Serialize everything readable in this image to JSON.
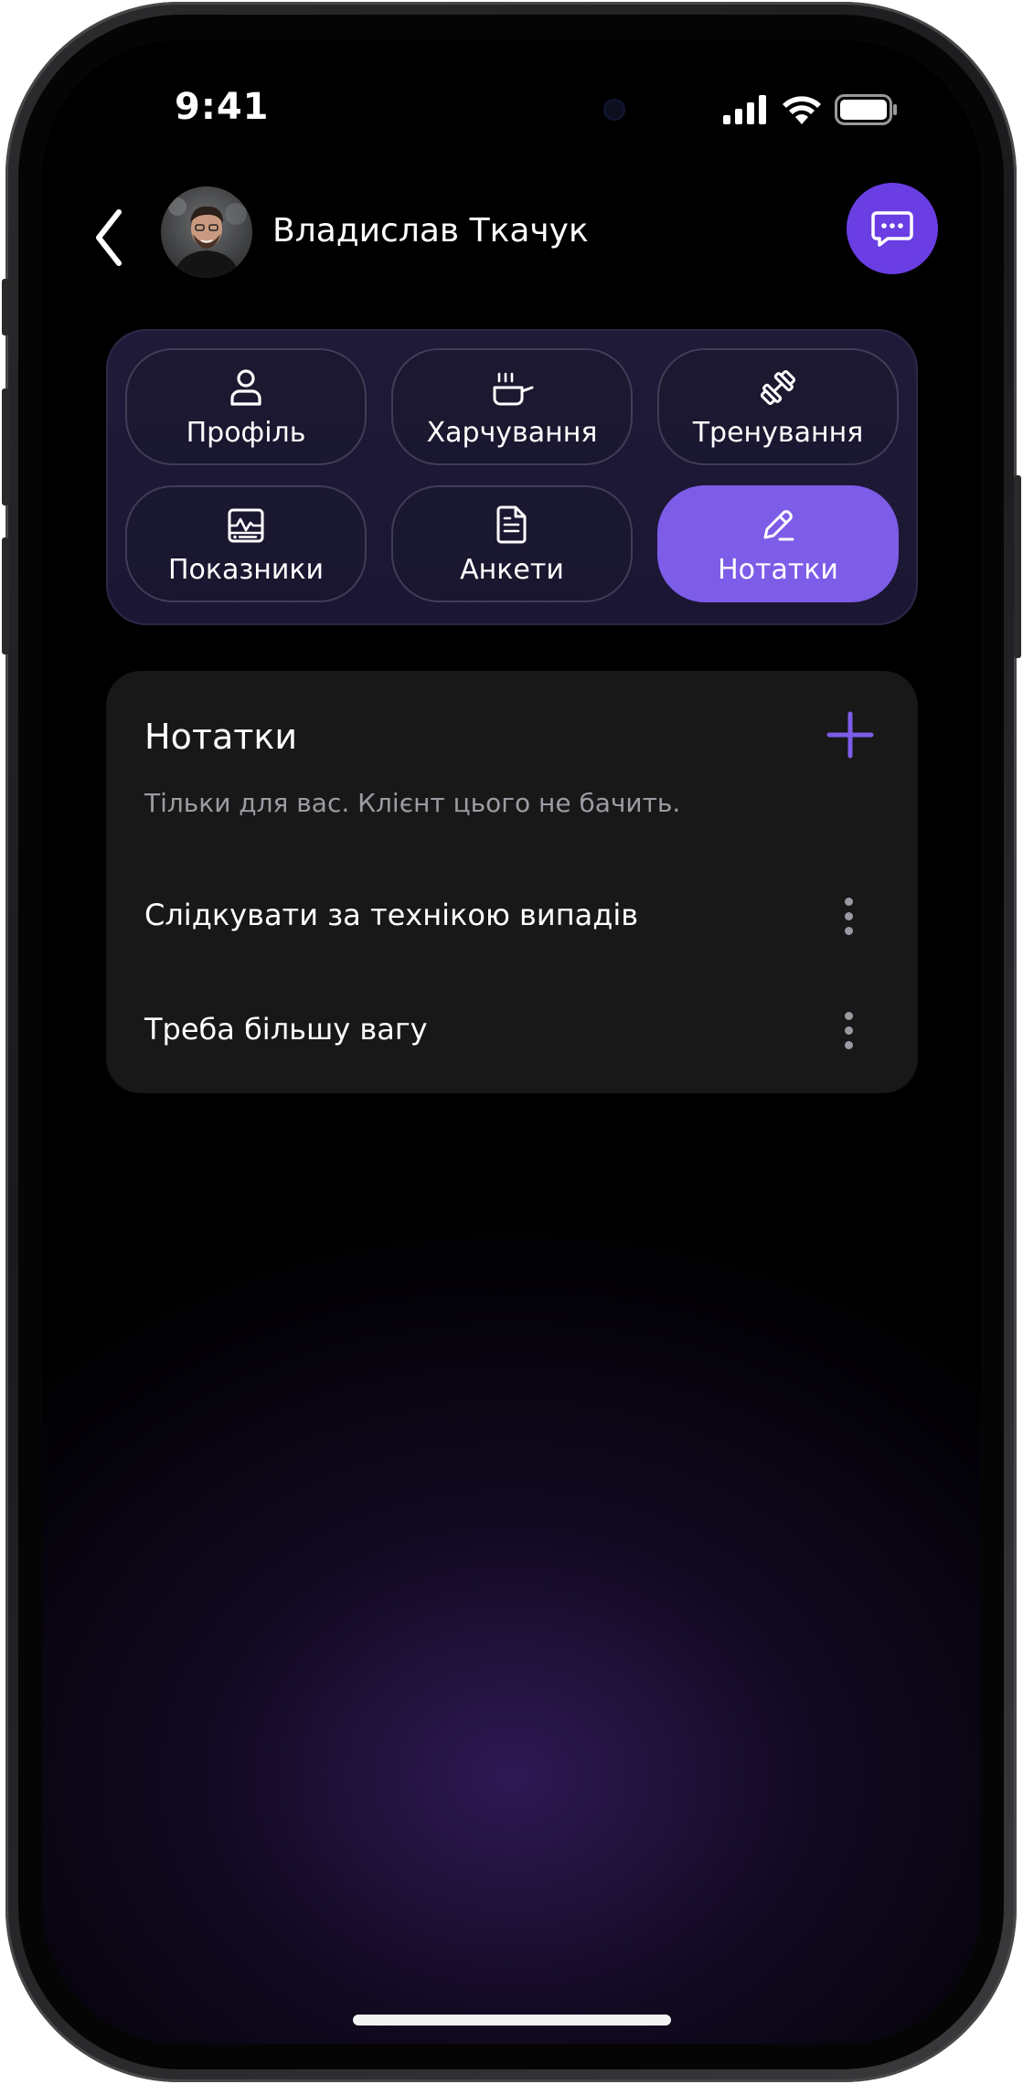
{
  "status_bar": {
    "time": "9:41"
  },
  "header": {
    "back_icon": "chevron-left-icon",
    "user_name": "Владислав Ткачук",
    "chat_icon": "chat-bubble-icon"
  },
  "tabs": [
    {
      "label": "Профіль",
      "icon": "person-icon",
      "active": false
    },
    {
      "label": "Харчування",
      "icon": "cooking-pot-icon",
      "active": false
    },
    {
      "label": "Тренування",
      "icon": "dumbbell-icon",
      "active": false
    },
    {
      "label": "Показники",
      "icon": "chart-icon",
      "active": false
    },
    {
      "label": "Анкети",
      "icon": "document-icon",
      "active": false
    },
    {
      "label": "Нотатки",
      "icon": "pencil-icon",
      "active": true
    }
  ],
  "notes": {
    "title": "Нотатки",
    "subtitle": "Тільки для вас. Клієнт цього не бачить.",
    "items": [
      {
        "text": "Слідкувати за технікою випадів"
      },
      {
        "text": "Треба більшу вагу"
      }
    ]
  },
  "colors": {
    "accent": "#7d5ce8",
    "chat_button": "#6a3ee3",
    "background": "#000000",
    "card": "#181818"
  }
}
